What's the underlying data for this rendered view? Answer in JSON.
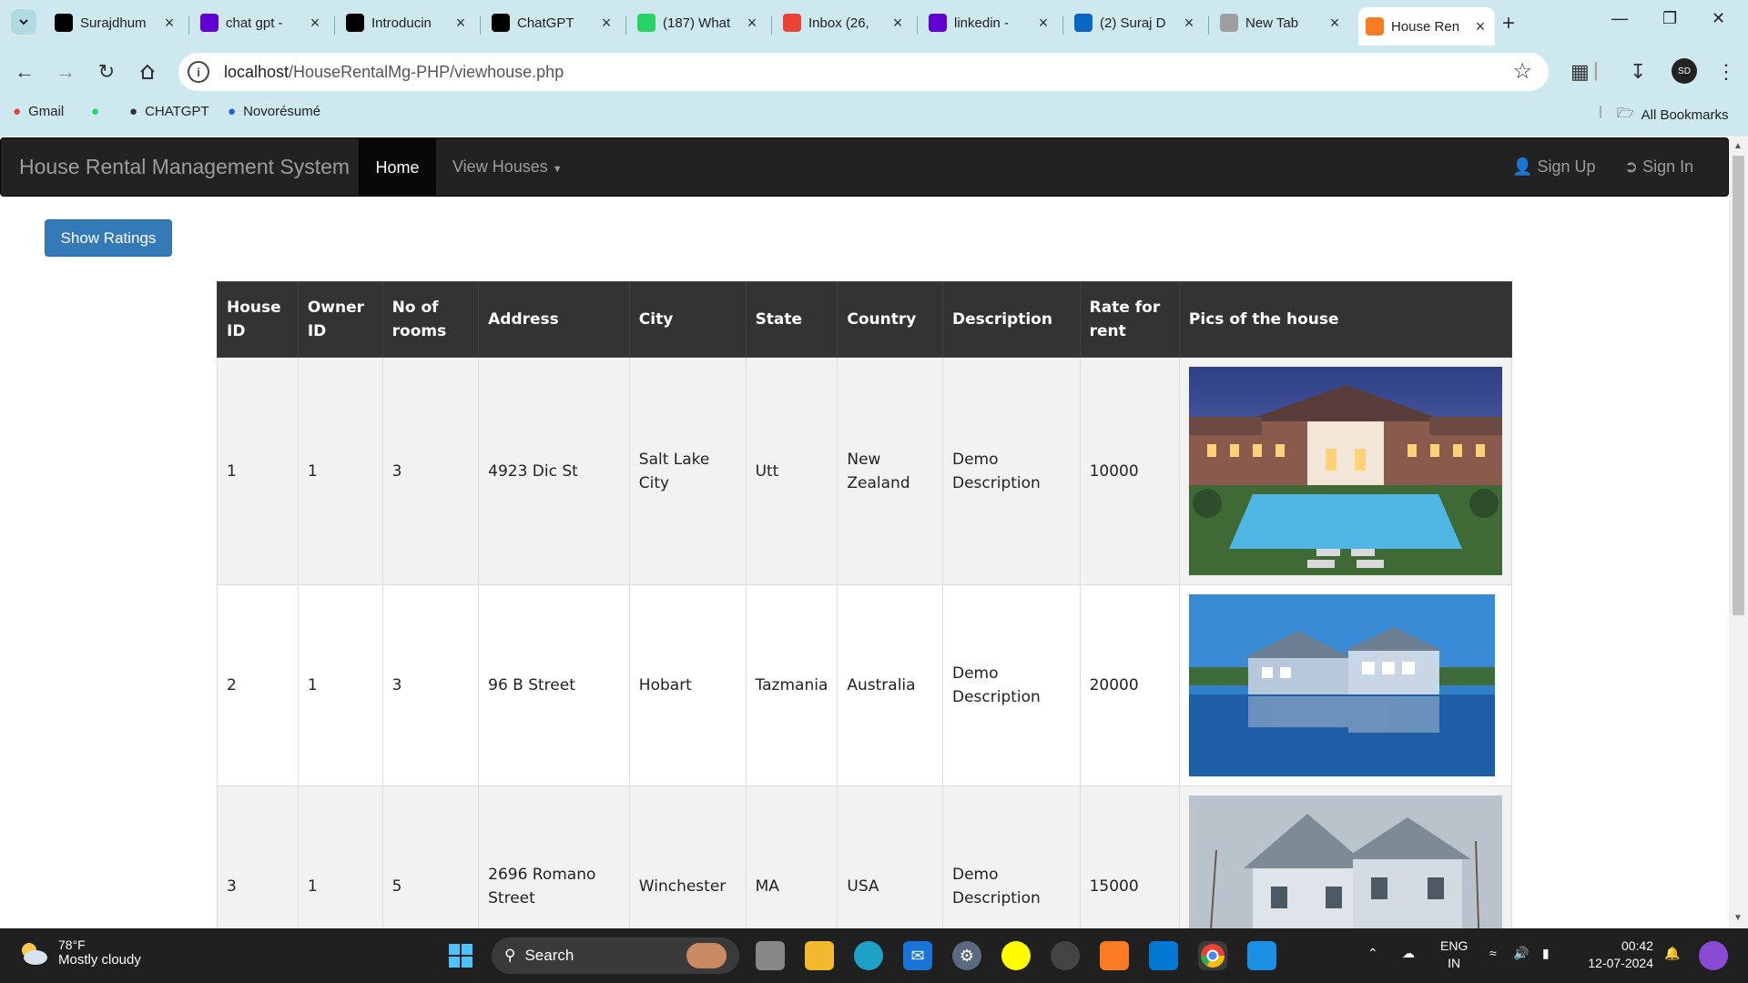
{
  "browser": {
    "tabs": [
      {
        "label": "Surajdhum",
        "icon": "github-icon",
        "color": "#000000"
      },
      {
        "label": "chat gpt -",
        "icon": "yahoo-icon",
        "color": "#6001d2"
      },
      {
        "label": "Introducin",
        "icon": "openai-icon",
        "color": "#000000"
      },
      {
        "label": "ChatGPT",
        "icon": "openai-icon",
        "color": "#000000"
      },
      {
        "label": "(187) What",
        "icon": "whatsapp-icon",
        "color": "#25d366"
      },
      {
        "label": "Inbox (26,",
        "icon": "gmail-icon",
        "color": "#ea4335"
      },
      {
        "label": "linkedin -",
        "icon": "yahoo-icon",
        "color": "#6001d2"
      },
      {
        "label": "(2) Suraj D",
        "icon": "linkedin-icon",
        "color": "#0a66c2"
      },
      {
        "label": "New Tab",
        "icon": "chrome-icon",
        "color": "#9e9e9e"
      },
      {
        "label": "House Ren",
        "icon": "xampp-icon",
        "color": "#fb7a24"
      }
    ],
    "address": {
      "host": "localhost",
      "path": "/HouseRentalMg-PHP/viewhouse.php"
    },
    "bookmarks": [
      {
        "label": "Gmail",
        "icon": "gmail-icon"
      },
      {
        "label": "",
        "icon": "whatsapp-icon"
      },
      {
        "label": "CHATGPT",
        "icon": "openai-icon"
      },
      {
        "label": "Novorésumé",
        "icon": "novoresume-icon"
      }
    ],
    "all_bookmarks": "All Bookmarks",
    "avatar_initials": "SD"
  },
  "navbar": {
    "brand": "House Rental Management System",
    "home": "Home",
    "view_houses": "View Houses",
    "sign_up": "Sign Up",
    "sign_in": "Sign In"
  },
  "show_ratings": "Show Ratings",
  "table": {
    "headers": [
      "House ID",
      "Owner ID",
      "No of rooms",
      "Address",
      "City",
      "State",
      "Country",
      "Description",
      "Rate for rent",
      "Pics of the house"
    ],
    "rows": [
      {
        "house_id": "1",
        "owner_id": "1",
        "rooms": "3",
        "address": "4923 Dic St",
        "city": "Salt Lake City",
        "state": "Utt",
        "country": "New Zealand",
        "description": "Demo Description",
        "rate": "10000"
      },
      {
        "house_id": "2",
        "owner_id": "1",
        "rooms": "3",
        "address": "96 B Street",
        "city": "Hobart",
        "state": "Tazmania",
        "country": "Australia",
        "description": "Demo Description",
        "rate": "20000"
      },
      {
        "house_id": "3",
        "owner_id": "1",
        "rooms": "5",
        "address": "2696 Romano Street",
        "city": "Winchester",
        "state": "MA",
        "country": "USA",
        "description": "Demo Description",
        "rate": "15000"
      }
    ]
  },
  "taskbar": {
    "temperature": "78°F",
    "weather": "Mostly cloudy",
    "search": "Search",
    "lang1": "ENG",
    "lang2": "IN",
    "time": "00:42",
    "date": "12-07-2024"
  }
}
